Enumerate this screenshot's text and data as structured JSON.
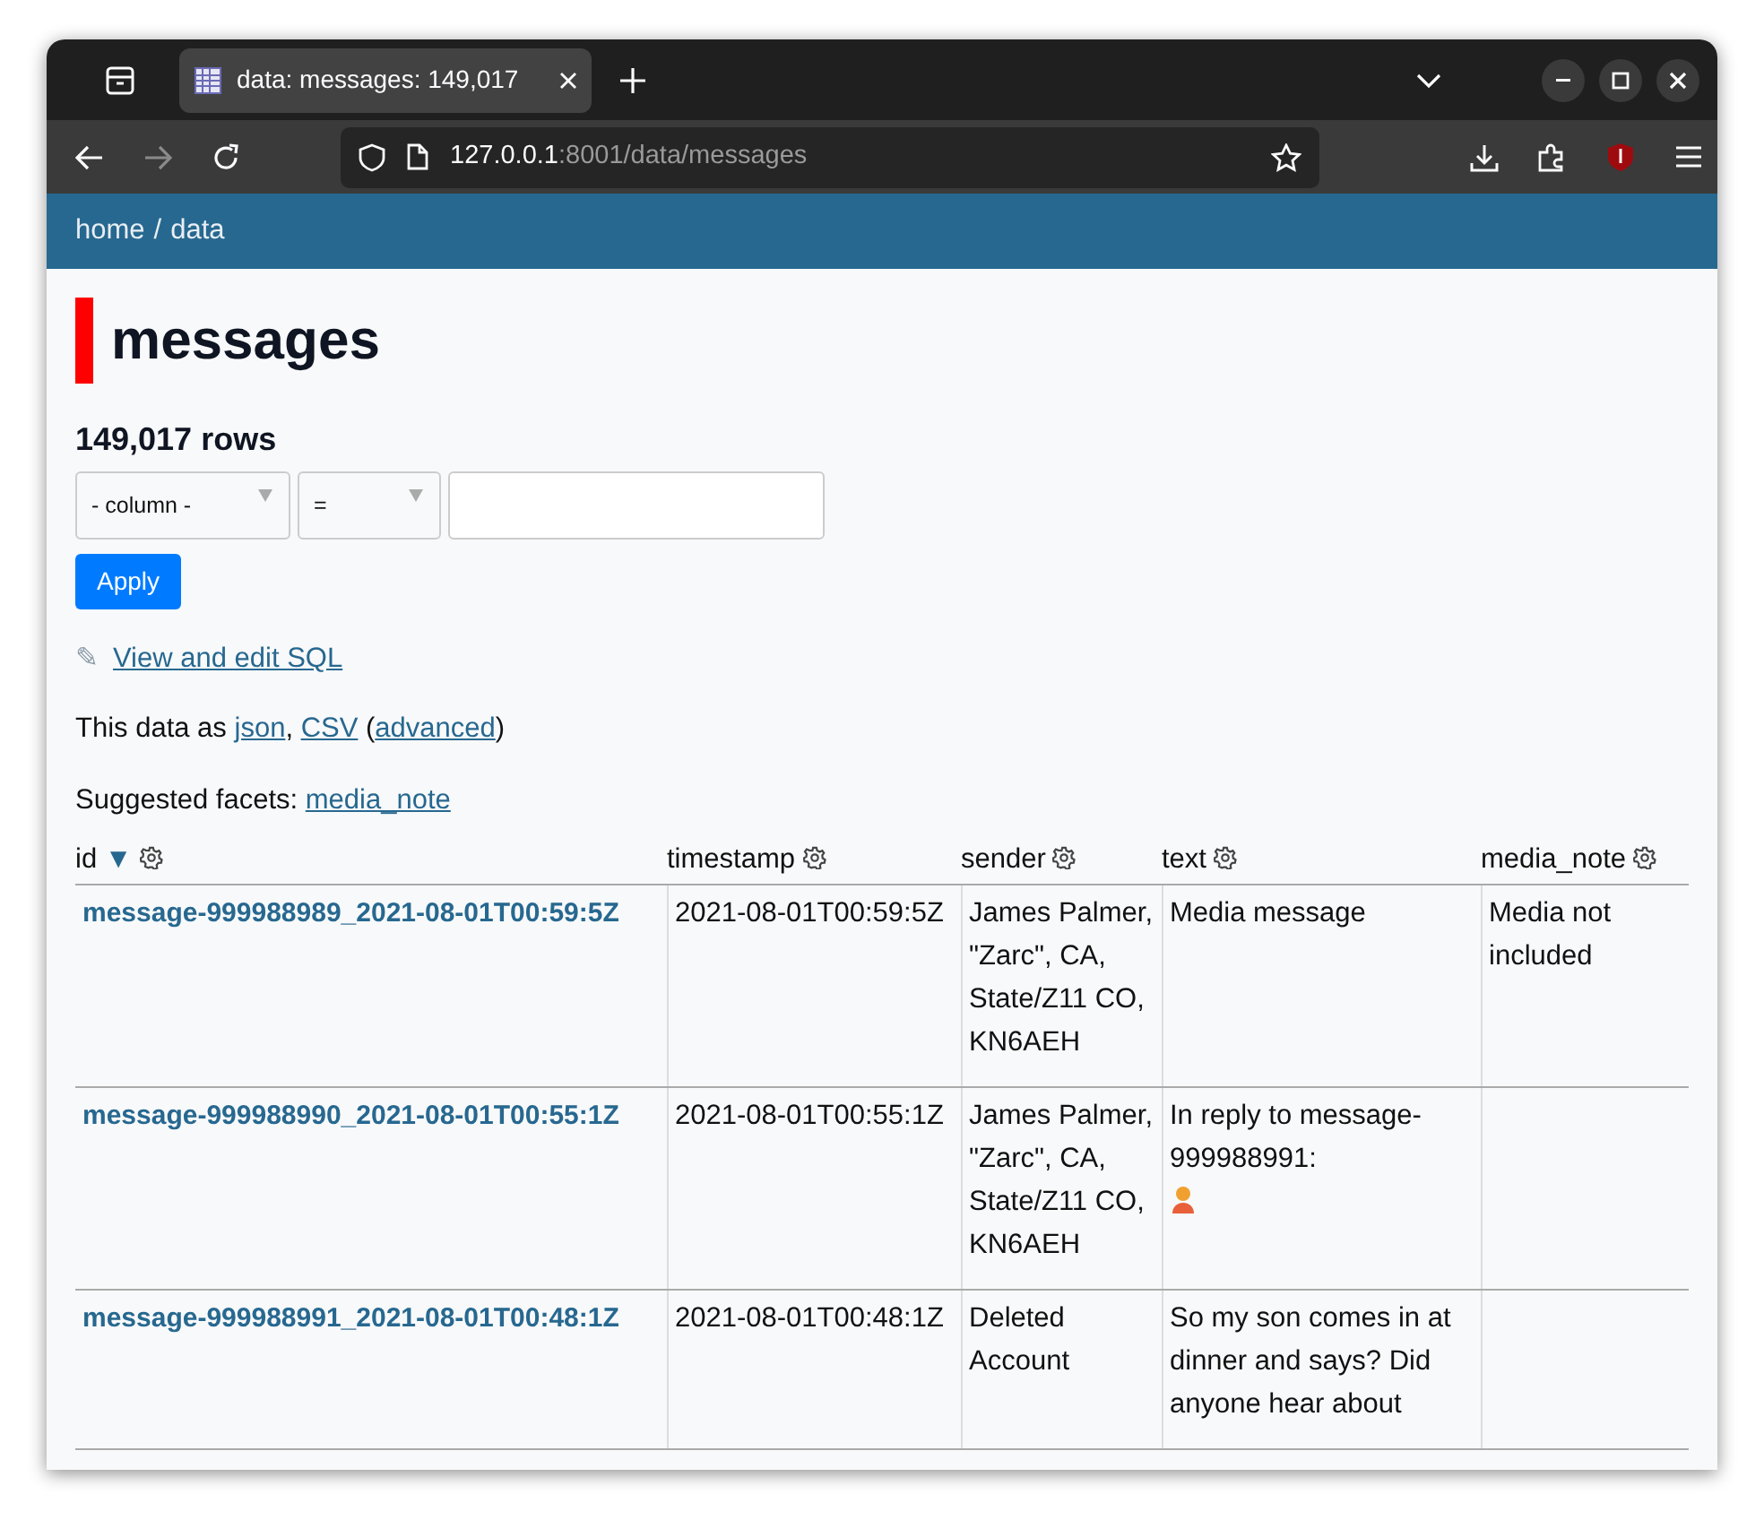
{
  "browser": {
    "tabs": [
      {
        "title": "data: messages: 149,017",
        "selected": true
      }
    ],
    "url": {
      "host": "127.0.0.1",
      "rest": ":8001/data/messages"
    }
  },
  "breadcrumbs": {
    "items": [
      "home",
      "data"
    ],
    "separator": "/"
  },
  "title": "messages",
  "row_count": "149,017 rows",
  "filter": {
    "column_placeholder": "- column -",
    "operator": "="
  },
  "apply_button": "Apply",
  "sql_link": {
    "icon": "✎",
    "label": "View and edit SQL"
  },
  "export_line": [
    {
      "kind": "text",
      "text": "This data as "
    },
    {
      "kind": "link",
      "text": "json"
    },
    {
      "kind": "text",
      "text": ", "
    },
    {
      "kind": "link",
      "text": "CSV"
    },
    {
      "kind": "text",
      "text": " ("
    },
    {
      "kind": "link",
      "text": "advanced"
    },
    {
      "kind": "text",
      "text": ")"
    }
  ],
  "facets": {
    "label": "Suggested facets: ",
    "links": [
      "media_note"
    ]
  },
  "table": {
    "columns": [
      {
        "label": "id",
        "sorted": true,
        "sort_indicator": "▼"
      },
      {
        "label": "timestamp",
        "sorted": false
      },
      {
        "label": "sender",
        "sorted": false
      },
      {
        "label": "text",
        "sorted": false
      },
      {
        "label": "media_note",
        "sorted": false
      }
    ],
    "rows": [
      {
        "id": "message-999988989_2021-08-01T00:59:5Z",
        "timestamp": "2021-08-01T00:59:5Z",
        "sender": "James Palmer, \"Zarc\", CA, State/Z11 CO, KN6AEH",
        "text": "Media message",
        "media_note": "Media not included"
      },
      {
        "id": "message-999988990_2021-08-01T00:55:1Z",
        "timestamp": "2021-08-01T00:55:1Z",
        "sender": "James Palmer, \"Zarc\", CA, State/Z11 CO, KN6AEH",
        "text": "In reply to message-999988991:",
        "kind": "text-with-icon"
      },
      {
        "id": "message-999988991_2021-08-01T00:48:1Z",
        "timestamp": "2021-08-01T00:48:1Z",
        "sender": "Deleted Account",
        "text": "So my son comes in at dinner and says? Did anyone hear about"
      }
    ]
  }
}
